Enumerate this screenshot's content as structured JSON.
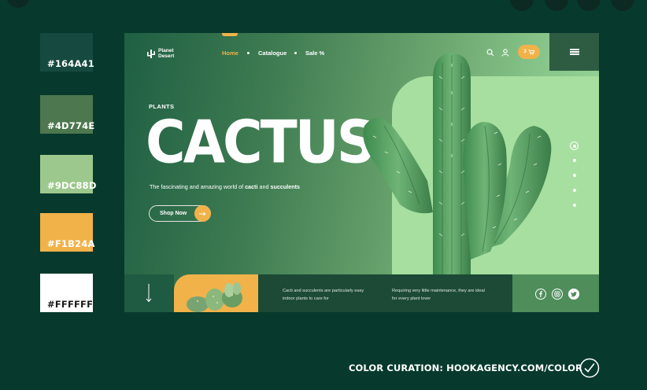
{
  "swatches": [
    {
      "hex": "#164A41",
      "label": "#164A41"
    },
    {
      "hex": "#4D774E",
      "label": "#4D774E"
    },
    {
      "hex": "#9DC88D",
      "label": "#9DC88D"
    },
    {
      "hex": "#F1B24A",
      "label": "#F1B24A"
    },
    {
      "hex": "#FFFFFF",
      "label": "#FFFFFF"
    }
  ],
  "mockup": {
    "logo_line1": "Planet",
    "logo_line2": "Desert",
    "nav": {
      "home": "Home",
      "catalogue": "Catalogue",
      "sale": "Sale %"
    },
    "cart_count": "3",
    "eyebrow": "PLANTS",
    "title": "CACTUS",
    "tagline_prefix": "The fascinating and amazing world of ",
    "tagline_bold1": "cacti",
    "tagline_mid": " and ",
    "tagline_bold2": "succulents",
    "shop_button": "Shop Now",
    "bottom_text1": "Cacti and succulents are particularly easy indoor plants to care for",
    "bottom_text2": "Requiring very little maintenance, they are ideal for every plant lover"
  },
  "footer": {
    "credit": "COLOR CURATION: HOOKAGENCY.COM/COLOR"
  },
  "colors": {
    "background": "#073a2d",
    "accent_yellow": "#F1B24A",
    "dark_green": "#164A41",
    "mid_green": "#4D774E",
    "light_green": "#9DC88D"
  },
  "icons": [
    "search-icon",
    "user-icon",
    "cart-icon",
    "menu-icon",
    "arrow-right-icon",
    "arrow-down-icon",
    "facebook-icon",
    "instagram-icon",
    "twitter-icon",
    "check-circle-icon"
  ]
}
